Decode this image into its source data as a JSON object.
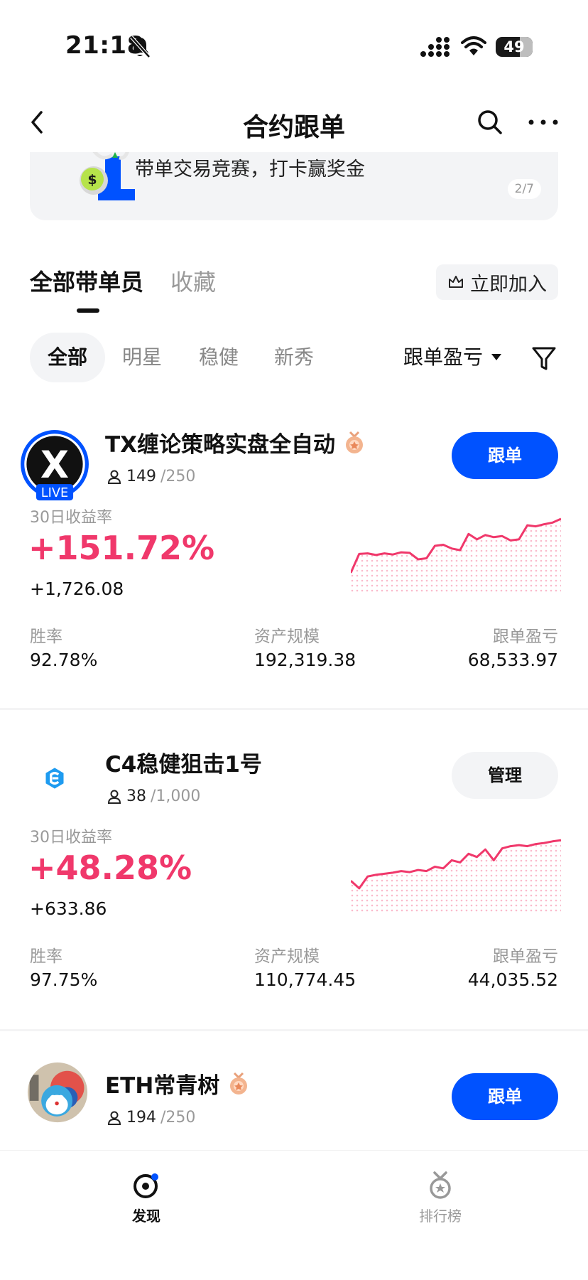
{
  "status_bar": {
    "time": "21:18",
    "battery": "49"
  },
  "header": {
    "title": "合约跟单"
  },
  "banner": {
    "text": "带单交易竞赛，打卡赢奖金",
    "page_indicator": "2/7"
  },
  "tabs": [
    {
      "label": "全部带单员",
      "active": true
    },
    {
      "label": "收藏",
      "active": false
    }
  ],
  "join_button": {
    "label": "立即加入"
  },
  "filters": {
    "chips": [
      {
        "label": "全部",
        "active": true
      },
      {
        "label": "明星",
        "active": false
      },
      {
        "label": "稳健",
        "active": false
      },
      {
        "label": "新秀",
        "active": false
      }
    ],
    "sort_label": "跟单盈亏"
  },
  "cards": [
    {
      "name": "TX缠论策略实盘全自动",
      "followers": "149",
      "followers_cap": "/250",
      "live_badge": "LIVE",
      "avatar_letter": "X",
      "has_medal": true,
      "button_label": "跟单",
      "button_style": "primary",
      "roi_label": "30日收益率",
      "roi": "+151.72%",
      "pnl": "+1,726.08",
      "stats": [
        {
          "label": "胜率",
          "value": "92.78%"
        },
        {
          "label": "资产规模",
          "value": "192,319.38"
        },
        {
          "label": "跟单盈亏",
          "value": "68,533.97"
        }
      ],
      "sparkline": [
        0,
        0.35,
        0.36,
        0.33,
        0.36,
        0.34,
        0.38,
        0.37,
        0.25,
        0.27,
        0.5,
        0.52,
        0.45,
        0.42,
        0.72,
        0.62,
        0.7,
        0.66,
        0.68,
        0.6,
        0.62,
        0.88,
        0.86,
        0.9,
        0.93,
        1.0
      ]
    },
    {
      "name": "C4稳健狙击1号",
      "followers": "38",
      "followers_cap": "/1,000",
      "has_medal": false,
      "button_label": "管理",
      "button_style": "secondary",
      "roi_label": "30日收益率",
      "roi": "+48.28%",
      "pnl": "+633.86",
      "stats": [
        {
          "label": "胜率",
          "value": "97.75%"
        },
        {
          "label": "资产规模",
          "value": "110,774.45"
        },
        {
          "label": "跟单盈亏",
          "value": "44,035.52"
        }
      ],
      "sparkline": [
        0.22,
        0.08,
        0.3,
        0.33,
        0.35,
        0.37,
        0.4,
        0.38,
        0.42,
        0.4,
        0.48,
        0.45,
        0.6,
        0.56,
        0.72,
        0.66,
        0.8,
        0.6,
        0.82,
        0.86,
        0.88,
        0.86,
        0.9,
        0.92,
        0.95,
        0.97
      ]
    },
    {
      "name": "ETH常青树",
      "followers": "194",
      "followers_cap": "/250",
      "has_medal": true,
      "button_label": "跟单",
      "button_style": "primary"
    }
  ],
  "bottom_nav": [
    {
      "label": "发现",
      "active": true,
      "icon": "discover-icon"
    },
    {
      "label": "排行榜",
      "active": false,
      "icon": "ranking-medal-icon"
    }
  ],
  "colors": {
    "accent": "#0052ff",
    "profit": "#f0386b",
    "muted": "#999999"
  }
}
